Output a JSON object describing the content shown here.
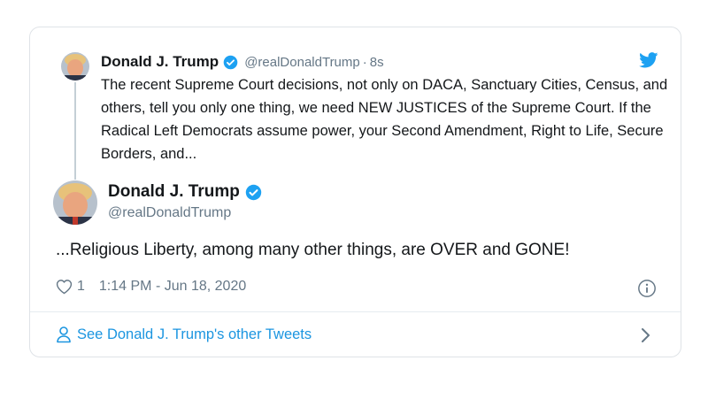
{
  "parent_tweet": {
    "author_name": "Donald J. Trump",
    "handle": "@realDonaldTrump",
    "separator": "·",
    "relative_time": "8s",
    "text": "The recent Supreme Court decisions, not only on DACA, Sanctuary Cities, Census, and others, tell you only one thing, we need NEW JUSTICES of the Supreme Court. If the Radical Left Democrats assume power, your Second Amendment, Right to Life, Secure Borders, and..."
  },
  "main_tweet": {
    "author_name": "Donald J. Trump",
    "handle": "@realDonaldTrump",
    "text": "...Religious Liberty, among many other things, are OVER and GONE!",
    "like_count": "1",
    "timestamp": "1:14 PM - Jun 18, 2020"
  },
  "footer": {
    "link_label": "See Donald J. Trump's other Tweets"
  },
  "icons": {
    "verified": "verified-badge-icon",
    "brand": "twitter-bird-icon",
    "like": "heart-icon",
    "info": "info-icon",
    "person": "person-icon",
    "chevron": "chevron-right-icon"
  },
  "colors": {
    "brand_blue": "#1da1f2",
    "link_blue": "#1b95e0",
    "muted_text": "#657786",
    "primary_text": "#14171a",
    "border": "#dfe3e7"
  }
}
